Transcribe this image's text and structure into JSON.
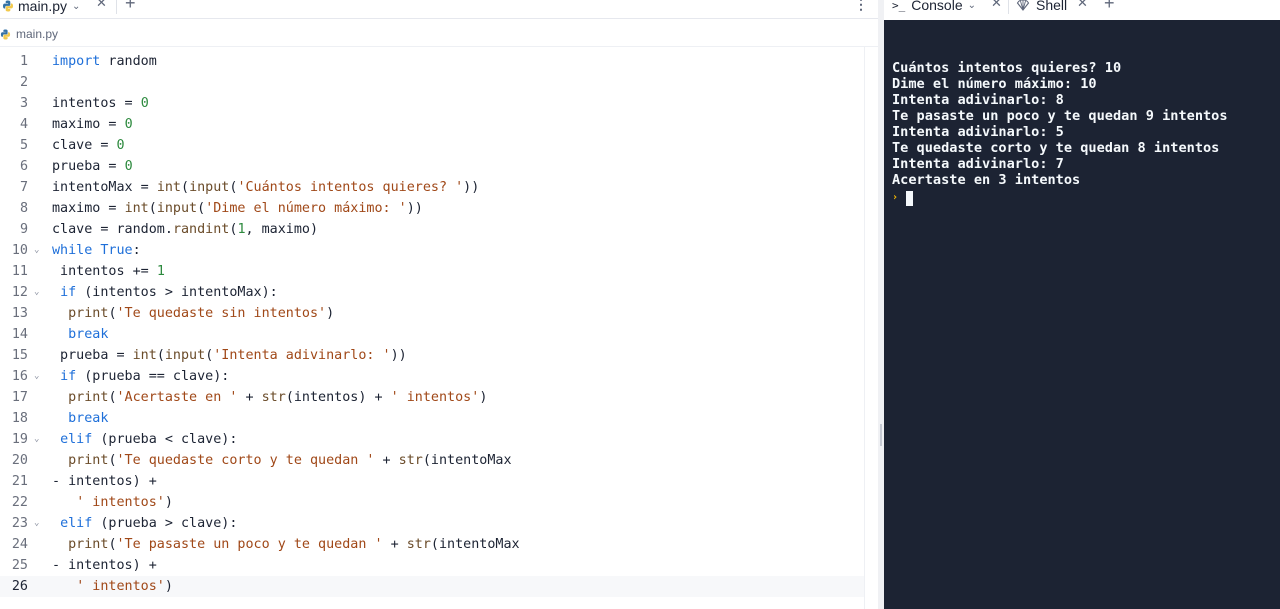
{
  "editor": {
    "tab": {
      "label": "main.py"
    },
    "breadcrumb": "main.py",
    "active_line": 26,
    "lines": [
      {
        "n": "1",
        "fold": false,
        "tokens": [
          [
            "k",
            "import"
          ],
          [
            "op",
            " random"
          ]
        ]
      },
      {
        "n": "2",
        "fold": false,
        "tokens": []
      },
      {
        "n": "3",
        "fold": false,
        "tokens": [
          [
            "op",
            "intentos = "
          ],
          [
            "n",
            "0"
          ]
        ]
      },
      {
        "n": "4",
        "fold": false,
        "tokens": [
          [
            "op",
            "maximo = "
          ],
          [
            "n",
            "0"
          ]
        ]
      },
      {
        "n": "5",
        "fold": false,
        "tokens": [
          [
            "op",
            "clave = "
          ],
          [
            "n",
            "0"
          ]
        ]
      },
      {
        "n": "6",
        "fold": false,
        "tokens": [
          [
            "op",
            "prueba = "
          ],
          [
            "n",
            "0"
          ]
        ]
      },
      {
        "n": "7",
        "fold": false,
        "tokens": [
          [
            "op",
            "intentoMax = "
          ],
          [
            "f",
            "int"
          ],
          [
            "op",
            "("
          ],
          [
            "f",
            "input"
          ],
          [
            "op",
            "("
          ],
          [
            "s",
            "'Cuántos intentos quieres? '"
          ],
          [
            "op",
            "))"
          ]
        ]
      },
      {
        "n": "8",
        "fold": false,
        "tokens": [
          [
            "op",
            "maximo = "
          ],
          [
            "f",
            "int"
          ],
          [
            "op",
            "("
          ],
          [
            "f",
            "input"
          ],
          [
            "op",
            "("
          ],
          [
            "s",
            "'Dime el número máximo: '"
          ],
          [
            "op",
            "))"
          ]
        ]
      },
      {
        "n": "9",
        "fold": false,
        "tokens": [
          [
            "op",
            "clave = random."
          ],
          [
            "f",
            "randint"
          ],
          [
            "op",
            "("
          ],
          [
            "n",
            "1"
          ],
          [
            "op",
            ", maximo)"
          ]
        ]
      },
      {
        "n": "10",
        "fold": true,
        "tokens": [
          [
            "k",
            "while"
          ],
          [
            "op",
            " "
          ],
          [
            "k",
            "True"
          ],
          [
            "op",
            ":"
          ]
        ]
      },
      {
        "n": "11",
        "fold": false,
        "tokens": [
          [
            "op",
            " intentos += "
          ],
          [
            "n",
            "1"
          ]
        ]
      },
      {
        "n": "12",
        "fold": true,
        "tokens": [
          [
            "op",
            " "
          ],
          [
            "k",
            "if"
          ],
          [
            "op",
            " (intentos > intentoMax):"
          ]
        ]
      },
      {
        "n": "13",
        "fold": false,
        "tokens": [
          [
            "op",
            "  "
          ],
          [
            "f",
            "print"
          ],
          [
            "op",
            "("
          ],
          [
            "s",
            "'Te quedaste sin intentos'"
          ],
          [
            "op",
            ")"
          ]
        ]
      },
      {
        "n": "14",
        "fold": false,
        "tokens": [
          [
            "op",
            "  "
          ],
          [
            "k",
            "break"
          ]
        ]
      },
      {
        "n": "15",
        "fold": false,
        "tokens": [
          [
            "op",
            " prueba = "
          ],
          [
            "f",
            "int"
          ],
          [
            "op",
            "("
          ],
          [
            "f",
            "input"
          ],
          [
            "op",
            "("
          ],
          [
            "s",
            "'Intenta adivinarlo: '"
          ],
          [
            "op",
            "))"
          ]
        ]
      },
      {
        "n": "16",
        "fold": true,
        "tokens": [
          [
            "op",
            " "
          ],
          [
            "k",
            "if"
          ],
          [
            "op",
            " (prueba == clave):"
          ]
        ]
      },
      {
        "n": "17",
        "fold": false,
        "tokens": [
          [
            "op",
            "  "
          ],
          [
            "f",
            "print"
          ],
          [
            "op",
            "("
          ],
          [
            "s",
            "'Acertaste en '"
          ],
          [
            "op",
            " + "
          ],
          [
            "f",
            "str"
          ],
          [
            "op",
            "(intentos) + "
          ],
          [
            "s",
            "' intentos'"
          ],
          [
            "op",
            ")"
          ]
        ]
      },
      {
        "n": "18",
        "fold": false,
        "tokens": [
          [
            "op",
            "  "
          ],
          [
            "k",
            "break"
          ]
        ]
      },
      {
        "n": "19",
        "fold": true,
        "tokens": [
          [
            "op",
            " "
          ],
          [
            "k",
            "elif"
          ],
          [
            "op",
            " (prueba < clave):"
          ]
        ]
      },
      {
        "n": "20",
        "fold": false,
        "tokens": [
          [
            "op",
            "  "
          ],
          [
            "f",
            "print"
          ],
          [
            "op",
            "("
          ],
          [
            "s",
            "'Te quedaste corto y te quedan '"
          ],
          [
            "op",
            " + "
          ],
          [
            "f",
            "str"
          ],
          [
            "op",
            "(intentoMax"
          ]
        ]
      },
      {
        "n": "21",
        "fold": false,
        "tokens": [
          [
            "op",
            "- intentos) +"
          ]
        ]
      },
      {
        "n": "22",
        "fold": false,
        "tokens": [
          [
            "op",
            "   "
          ],
          [
            "s",
            "' intentos'"
          ],
          [
            "op",
            ")"
          ]
        ]
      },
      {
        "n": "23",
        "fold": true,
        "tokens": [
          [
            "op",
            " "
          ],
          [
            "k",
            "elif"
          ],
          [
            "op",
            " (prueba > clave):"
          ]
        ]
      },
      {
        "n": "24",
        "fold": false,
        "tokens": [
          [
            "op",
            "  "
          ],
          [
            "f",
            "print"
          ],
          [
            "op",
            "("
          ],
          [
            "s",
            "'Te pasaste un poco y te quedan '"
          ],
          [
            "op",
            " + "
          ],
          [
            "f",
            "str"
          ],
          [
            "op",
            "(intentoMax"
          ]
        ]
      },
      {
        "n": "25",
        "fold": false,
        "tokens": [
          [
            "op",
            "- intentos) +"
          ]
        ]
      },
      {
        "n": "26",
        "fold": false,
        "tokens": [
          [
            "op",
            "   "
          ],
          [
            "s",
            "' intentos'"
          ],
          [
            "op",
            ")"
          ]
        ]
      }
    ]
  },
  "console": {
    "tabs": [
      {
        "label": "Console",
        "icon": "terminal-prompt-icon"
      },
      {
        "label": "Shell",
        "icon": "shell-icon"
      }
    ],
    "output": [
      "Cuántos intentos quieres? 10",
      "Dime el número máximo: 10",
      "Intenta adivinarlo: 8",
      "Te pasaste un poco y te quedan 9 intentos",
      "Intenta adivinarlo: 5",
      "Te quedaste corto y te quedan 8 intentos",
      "Intenta adivinarlo: 7",
      "Acertaste en 3 intentos"
    ]
  },
  "colors": {
    "keyword": "#1e6fd9",
    "number": "#2d8a3e",
    "string": "#a04818",
    "console_bg": "#1c2333",
    "prompt_arrow": "#f2b705"
  }
}
